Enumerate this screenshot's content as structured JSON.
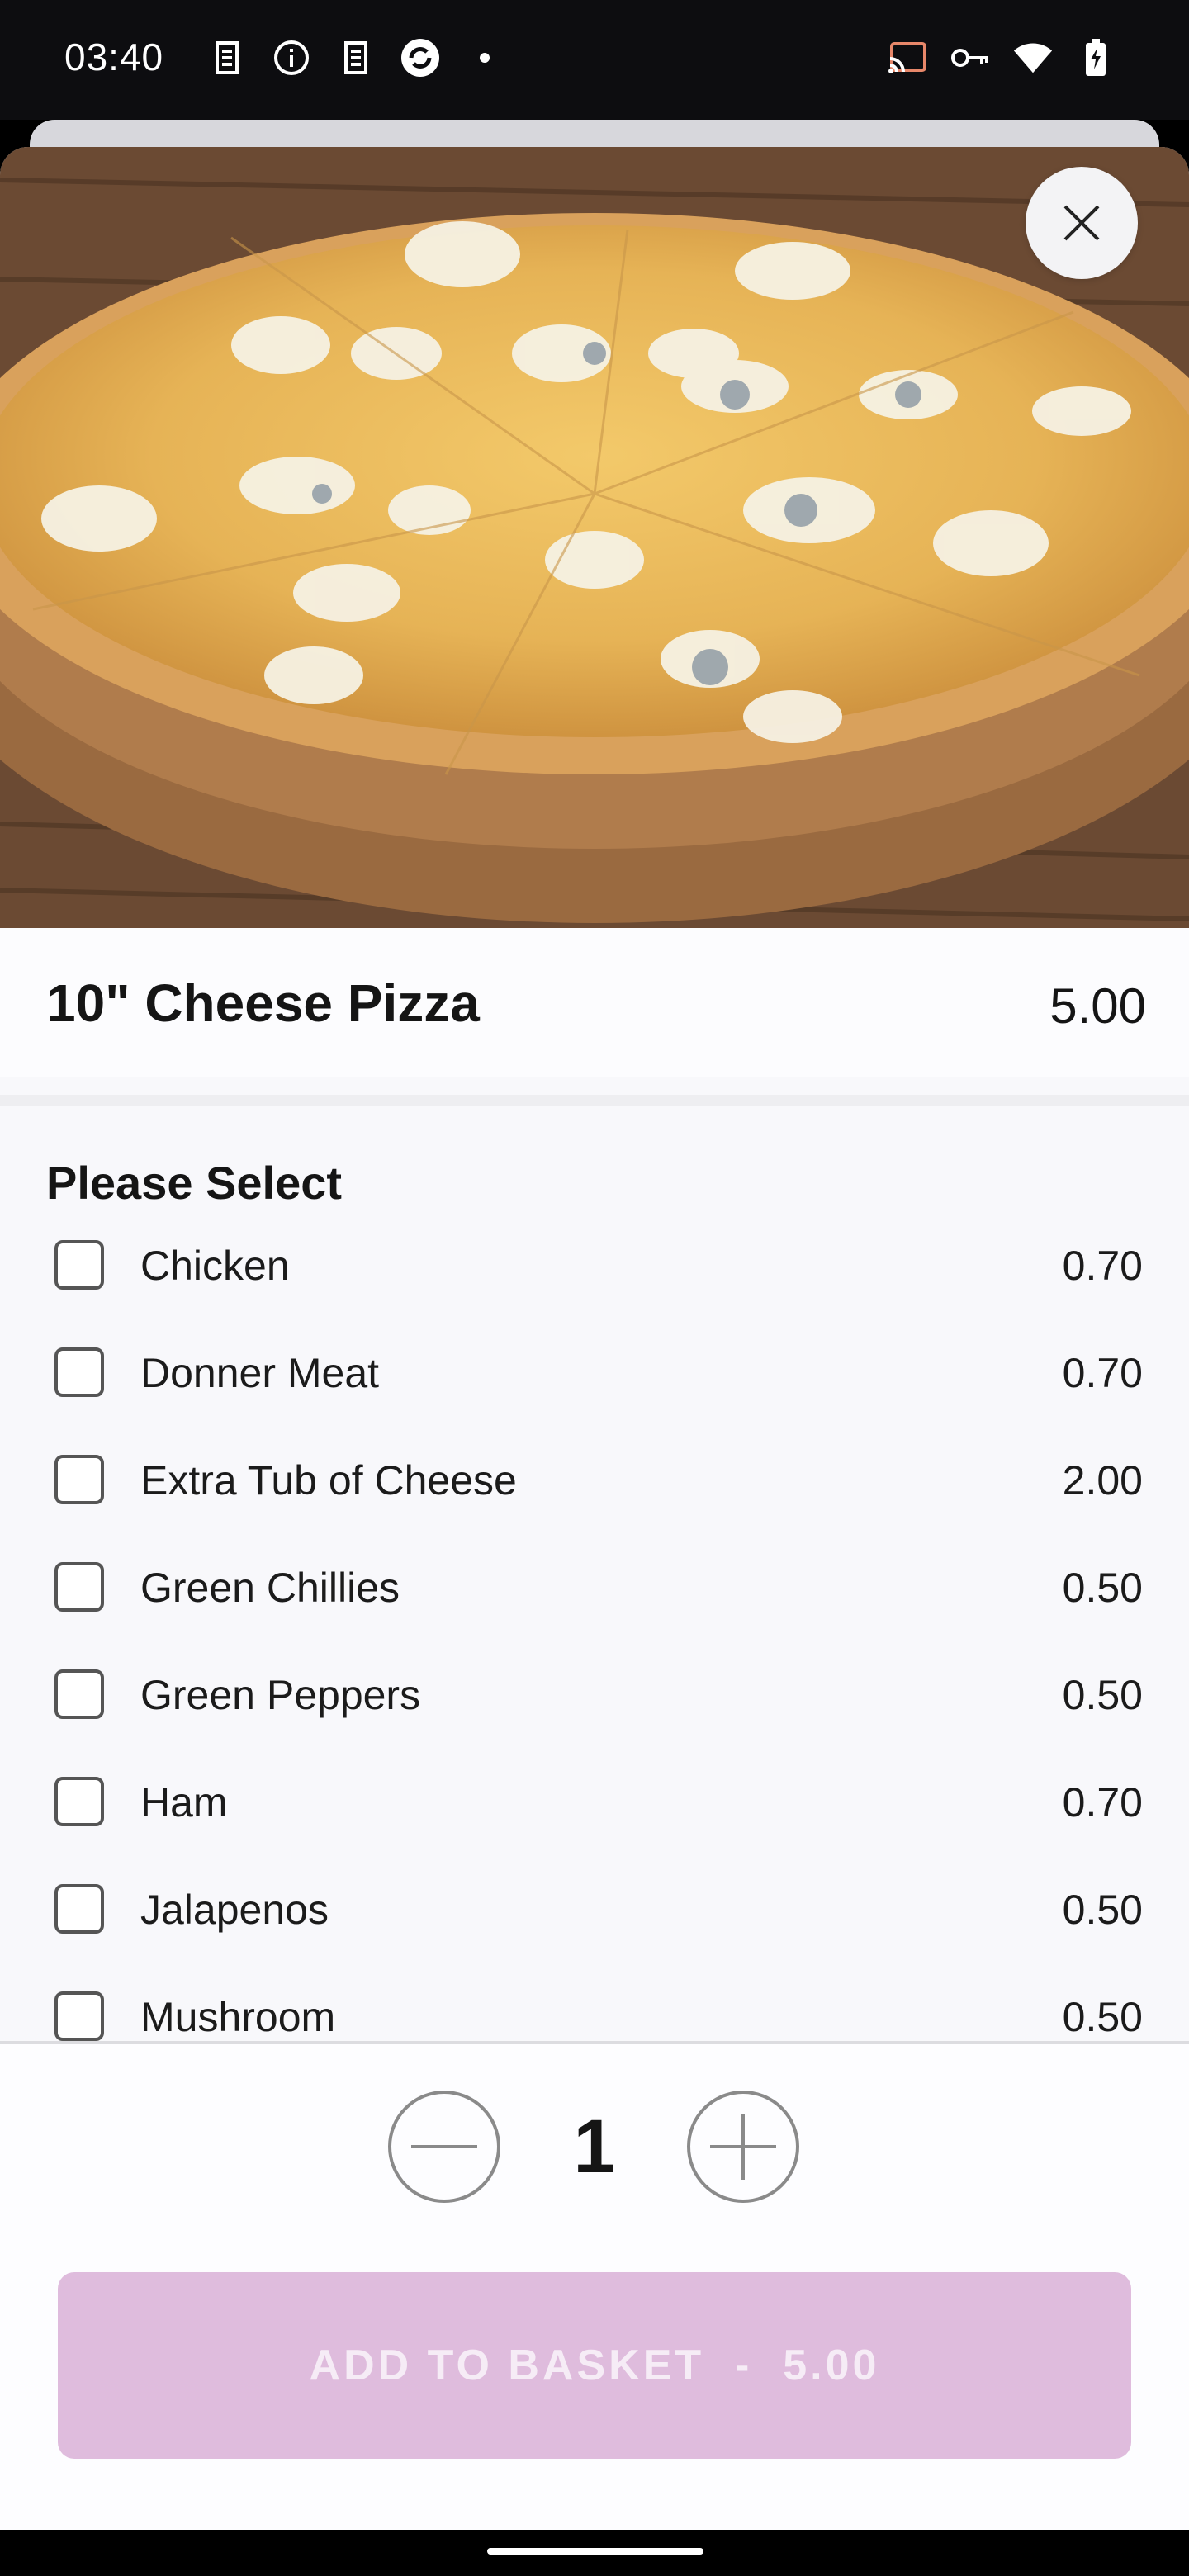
{
  "status_bar": {
    "time": "03:40",
    "left_icons": [
      "sim-icon",
      "info-icon",
      "sim-icon",
      "sync-icon",
      "dot-icon"
    ],
    "right_icons": [
      "cast-icon",
      "key-icon",
      "wifi-icon",
      "battery-charging-icon"
    ]
  },
  "product": {
    "name": "10\" Cheese Pizza",
    "price": "5.00"
  },
  "options_section": {
    "title": "Please Select",
    "items": [
      {
        "label": "Chicken",
        "price": "0.70",
        "checked": false
      },
      {
        "label": "Donner Meat",
        "price": "0.70",
        "checked": false
      },
      {
        "label": "Extra Tub of Cheese",
        "price": "2.00",
        "checked": false
      },
      {
        "label": "Green Chillies",
        "price": "0.50",
        "checked": false
      },
      {
        "label": "Green Peppers",
        "price": "0.50",
        "checked": false
      },
      {
        "label": "Ham",
        "price": "0.70",
        "checked": false
      },
      {
        "label": "Jalapenos",
        "price": "0.50",
        "checked": false
      },
      {
        "label": "Mushroom",
        "price": "0.50",
        "checked": false
      }
    ]
  },
  "footer": {
    "quantity": "1",
    "add_button_label": "ADD TO BASKET  -  5.00",
    "add_button_color": "#dfbcdd"
  }
}
